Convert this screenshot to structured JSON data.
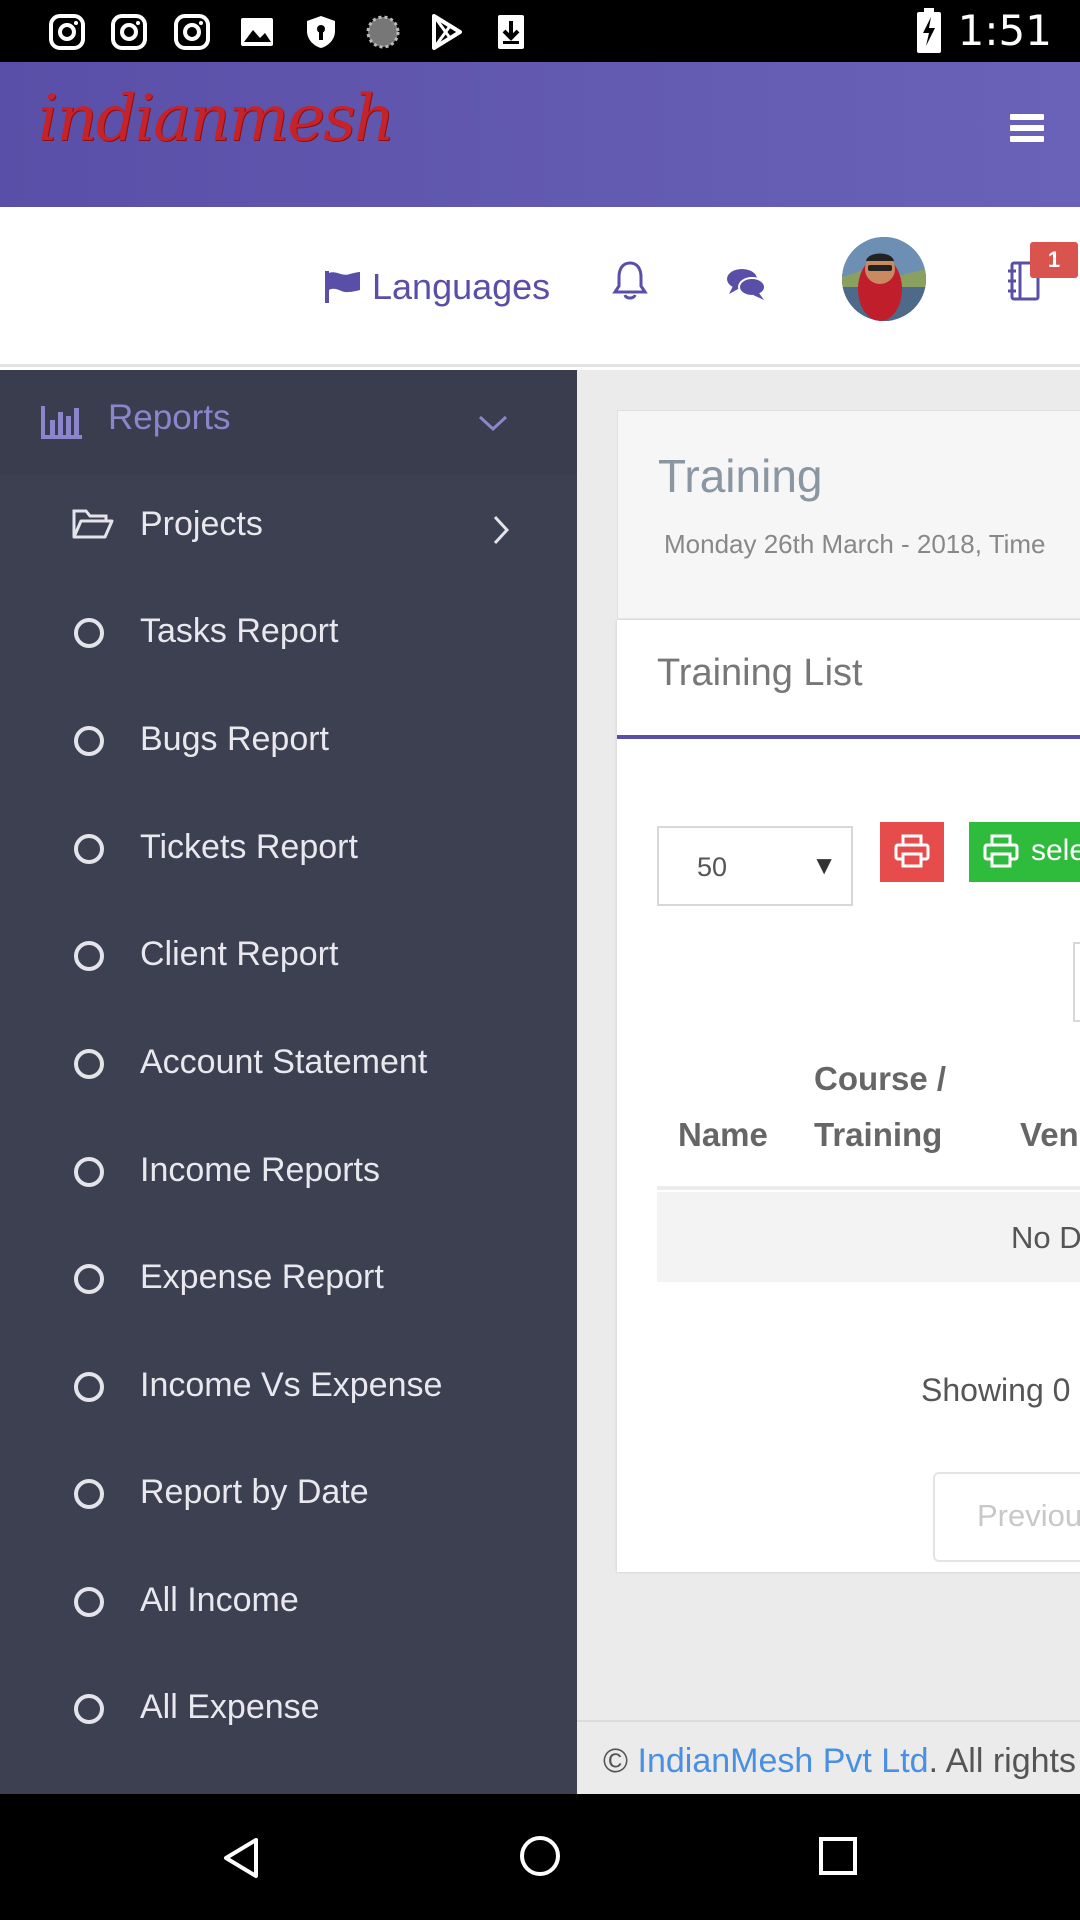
{
  "status_bar": {
    "time": "1:51",
    "icons": [
      "instagram-icon",
      "instagram-icon",
      "instagram-icon",
      "image-icon",
      "shield-icon",
      "spinner-icon",
      "play-store-icon",
      "download-icon",
      "battery-icon"
    ]
  },
  "header": {
    "logo_text": "indianmesh",
    "menu_icon": "hamburger-icon"
  },
  "topnav": {
    "languages_label": "Languages",
    "notification_badge": "1"
  },
  "sidebar": {
    "section_label": "Reports",
    "projects_label": "Projects",
    "items": [
      {
        "label": "Tasks Report"
      },
      {
        "label": "Bugs Report"
      },
      {
        "label": "Tickets Report"
      },
      {
        "label": "Client Report"
      },
      {
        "label": "Account Statement"
      },
      {
        "label": "Income Reports"
      },
      {
        "label": "Expense Report"
      },
      {
        "label": "Income Vs Expense"
      },
      {
        "label": "Report by Date"
      },
      {
        "label": "All Income"
      },
      {
        "label": "All Expense"
      }
    ]
  },
  "main": {
    "page_title": "Training",
    "page_subtitle": "Monday 26th March - 2018, Time",
    "card_title": "Training List",
    "page_length": "50",
    "select_button_label": "sele",
    "columns": {
      "name": "Name",
      "course_line1": "Course /",
      "course_line2": "Training",
      "venue": "Ven"
    },
    "empty_text": "No D",
    "showing_text": "Showing 0",
    "prev_label": "Previou",
    "footer": {
      "copyright": "©",
      "company": "IndianMesh Pvt Ltd",
      "rest": ". All rights"
    }
  },
  "colors": {
    "brand_purple": "#5a4fa8",
    "sidebar_bg": "#3d4051",
    "danger": "#e74c4c",
    "success": "#2fbb3b",
    "logo_red": "#c4232a"
  }
}
